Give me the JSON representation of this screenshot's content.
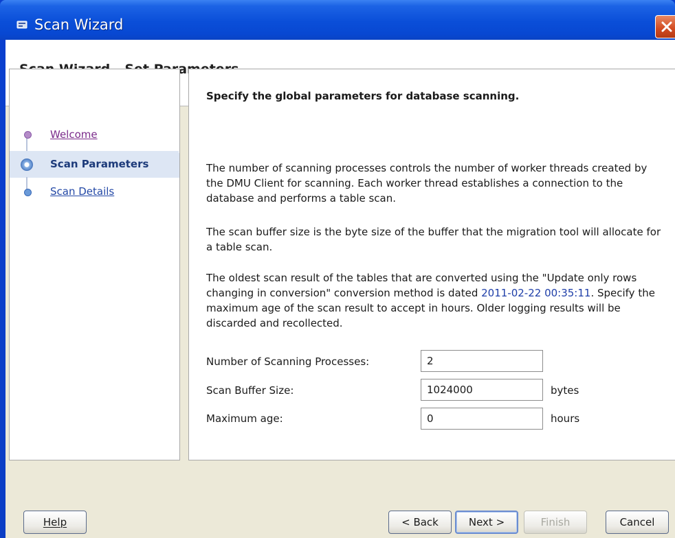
{
  "window": {
    "title": "Scan Wizard",
    "close_icon": "close-icon"
  },
  "header": {
    "title": "Scan Wizard - Set Parameters"
  },
  "nav": {
    "items": [
      {
        "label": "Welcome",
        "state": "visited"
      },
      {
        "label": "Scan Parameters",
        "state": "current"
      },
      {
        "label": "Scan Details",
        "state": "link"
      }
    ]
  },
  "content": {
    "heading": "Specify the global parameters for database scanning.",
    "para1": "The number of scanning processes controls the number of worker threads created by the DMU Client for scanning. Each worker thread establishes a connection to the database and performs a table scan.",
    "para2": "The scan buffer size is the byte size of the buffer that the migration tool will allocate for a table scan.",
    "para3_before": "The oldest scan result of the tables that are converted using the \"Update only rows changing in conversion\" conversion method is dated ",
    "para3_date": "2011-02-22 00:35:11",
    "para3_after": ". Specify the maximum age of the scan result to accept in hours. Older logging results will be discarded and recollected.",
    "fields": [
      {
        "label": "Number of Scanning Processes:",
        "value": "2",
        "unit": ""
      },
      {
        "label": "Scan Buffer Size:",
        "value": "1024000",
        "unit": "bytes"
      },
      {
        "label": "Maximum age:",
        "value": "0",
        "unit": "hours"
      }
    ]
  },
  "buttons": {
    "help": "Help",
    "back": "< Back",
    "next": "Next >",
    "finish": "Finish",
    "cancel": "Cancel"
  },
  "colors": {
    "titlebar": "#0a4ed8",
    "link": "#2348a6",
    "visited_link": "#7a2a8a",
    "selected_nav_bg": "#dde6f4"
  }
}
